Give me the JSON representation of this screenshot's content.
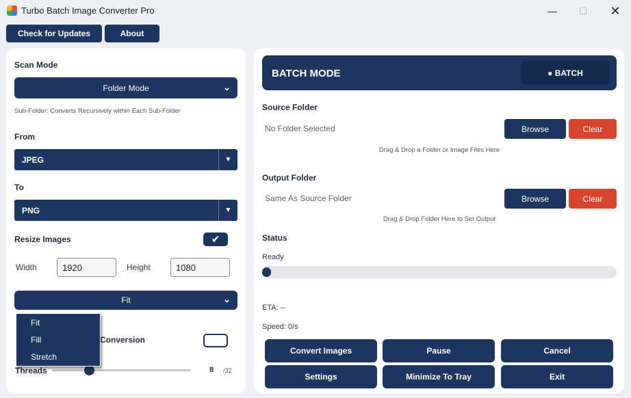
{
  "window": {
    "title": "Turbo Batch Image Converter Pro",
    "min": "—",
    "max": "☐",
    "close": "✕"
  },
  "topbar": {
    "check_updates": "Check for Updates",
    "about": "About"
  },
  "left": {
    "scan_mode_label": "Scan Mode",
    "scan_mode_value": "Folder Mode",
    "scan_mode_hint": "Sub-Folder: Converts Recursively within Each Sub-Folder",
    "from_label": "From",
    "from_value": "JPEG",
    "to_label": "To",
    "to_value": "PNG",
    "resize_label": "Resize Images",
    "resize_checked": true,
    "width_label": "Width",
    "width_value": "1920",
    "height_label": "Height",
    "height_value": "1080",
    "fit_value": "Fit",
    "fit_options": [
      "Fit",
      "Fill",
      "Stretch"
    ],
    "conversion_partial": "Conversion",
    "conversion_checked": false,
    "threads_label": "Threads",
    "threads_value": "8",
    "threads_max": "/32",
    "threads_fraction": 0.25
  },
  "right": {
    "mode_title": "BATCH MODE",
    "mode_pill": "● BATCH",
    "source_label": "Source Folder",
    "source_value": "No Folder Selected",
    "source_hint": "Drag & Drop a Folder or Image Files Here",
    "output_label": "Output Folder",
    "output_value": "Same As Source Folder",
    "output_hint": "Drag & Drop Folder Here to Set Output",
    "browse": "Browse",
    "clear": "Clear",
    "status_label": "Status",
    "status_value": "Ready",
    "progress": 0,
    "eta": "ETA: --",
    "speed": "Speed: 0/s"
  },
  "actions": {
    "convert": "Convert Images",
    "pause": "Pause",
    "cancel": "Cancel",
    "settings": "Settings",
    "minimize": "Minimize To Tray",
    "exit": "Exit"
  },
  "colors": {
    "navy": "#1c365f",
    "red": "#d6442e",
    "panel": "#ffffff",
    "background": "#eef0f4"
  }
}
